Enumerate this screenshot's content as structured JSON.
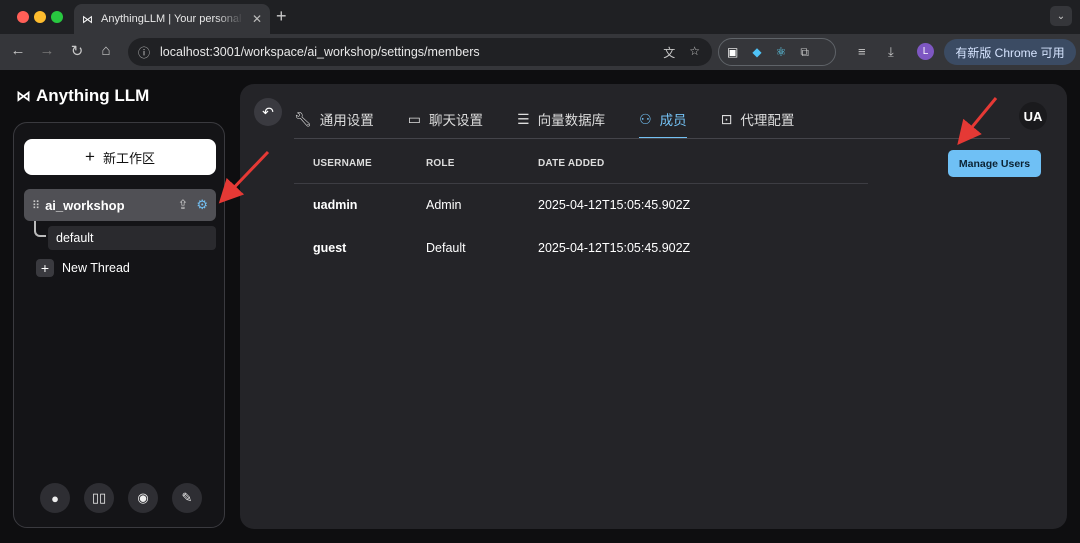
{
  "browser": {
    "tab_title": "AnythingLLM | Your personal AI",
    "tab_icon": "anythingllm-logo",
    "url": "localhost:3001/workspace/ai_workshop/settings/members",
    "profile_initial": "L",
    "update_label": "有新版 Chrome 可用"
  },
  "app": {
    "brand": "Anything LLM",
    "new_workspace_label": "新工作区",
    "workspace": {
      "name": "ai_workshop",
      "thread": "default"
    },
    "new_thread_label": "New Thread"
  },
  "settings": {
    "tabs": [
      {
        "label": "通用设置",
        "icon": "wrench-icon"
      },
      {
        "label": "聊天设置",
        "icon": "chat-icon"
      },
      {
        "label": "向量数据库",
        "icon": "database-icon"
      },
      {
        "label": "成员",
        "icon": "user-icon",
        "active": true
      },
      {
        "label": "代理配置",
        "icon": "robot-icon"
      }
    ],
    "user_initials": "UA",
    "manage_users_label": "Manage Users",
    "table": {
      "headers": [
        "USERNAME",
        "ROLE",
        "DATE ADDED"
      ],
      "rows": [
        [
          "uadmin",
          "Admin",
          "2025-04-12T15:05:45.902Z"
        ],
        [
          "guest",
          "Default",
          "2025-04-12T15:05:45.902Z"
        ]
      ]
    }
  },
  "colors": {
    "accent": "#73c0f3",
    "annotation": "#e53935"
  }
}
